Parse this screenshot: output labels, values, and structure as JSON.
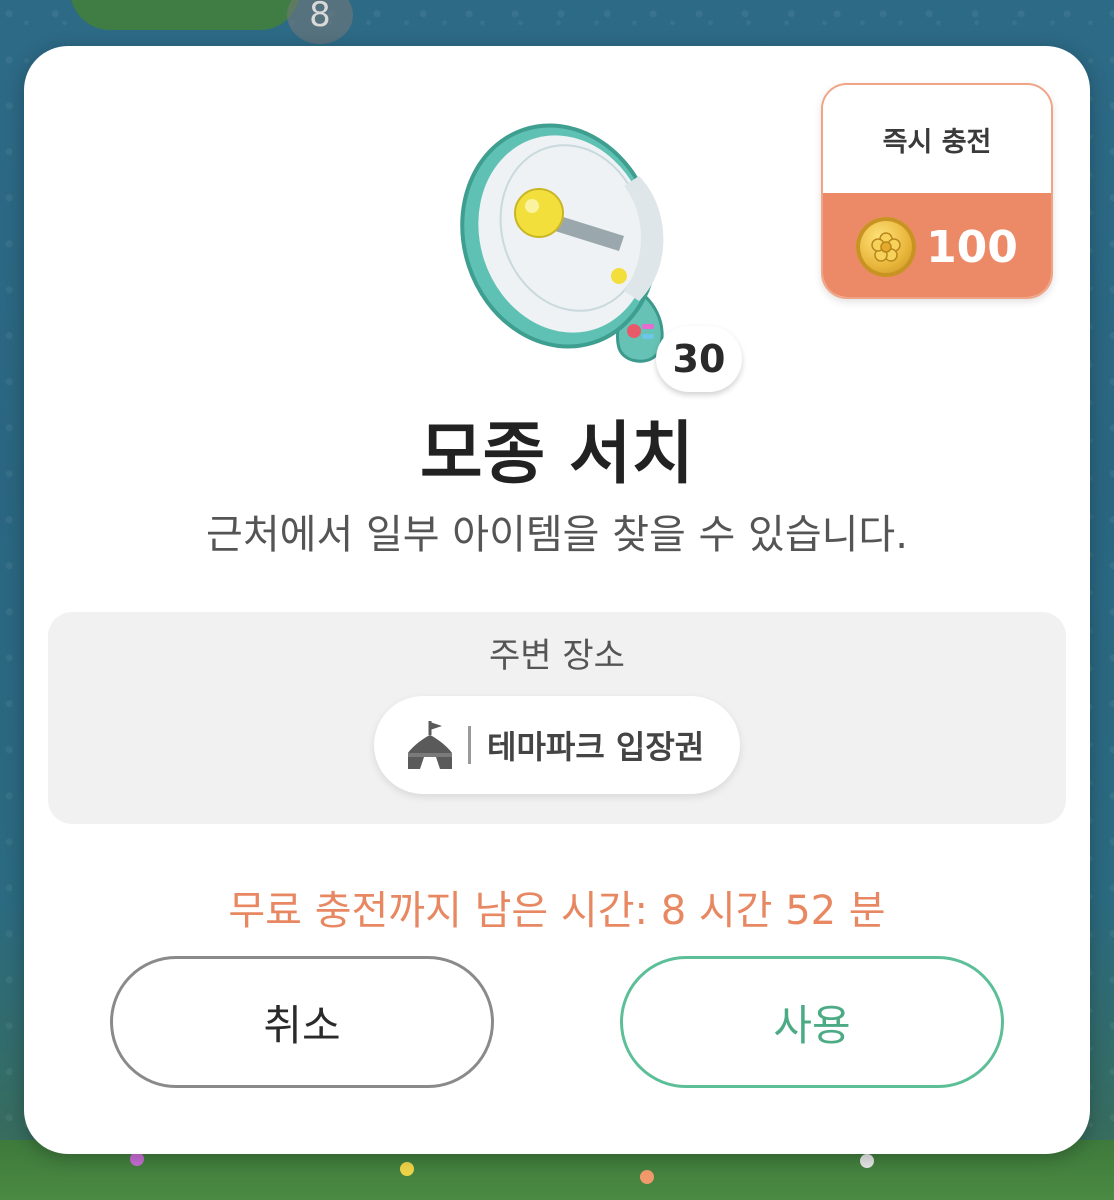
{
  "background": {
    "badge_number": "8"
  },
  "dialog": {
    "instant_charge": {
      "label": "즉시 충전",
      "coin_icon": "coin-icon",
      "amount": "100"
    },
    "item": {
      "icon": "megaphone-icon",
      "count": "30",
      "title": "모종 서치",
      "description": "근처에서 일부 아이템을 찾을 수 있습니다."
    },
    "nearby": {
      "label": "주변 장소",
      "place_icon": "tent-icon",
      "place_name": "테마파크 입장권"
    },
    "timer_text": "무료 충전까지 남은 시간: 8 시간 52 분",
    "buttons": {
      "cancel": "취소",
      "use": "사용"
    },
    "colors": {
      "accent_orange": "#ec8a68",
      "timer_orange": "#e88862",
      "accent_green": "#5dbf98"
    }
  }
}
